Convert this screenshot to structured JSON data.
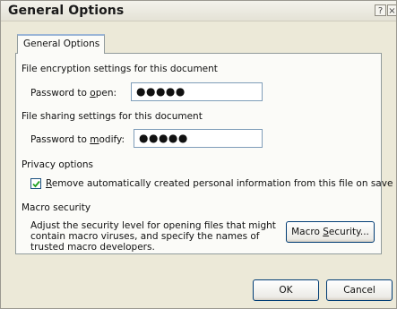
{
  "window": {
    "title": "General Options",
    "help_glyph": "?",
    "close_glyph": "×"
  },
  "tab": {
    "label": "General Options"
  },
  "encryption": {
    "heading": "File encryption settings for this document",
    "open_label_pre": "Password to ",
    "open_label_key": "o",
    "open_label_post": "pen:",
    "open_value": "●●●●●"
  },
  "sharing": {
    "heading": "File sharing settings for this document",
    "modify_label_pre": "Password to ",
    "modify_label_key": "m",
    "modify_label_post": "odify:",
    "modify_value": "●●●●●"
  },
  "privacy": {
    "heading": "Privacy options",
    "checkbox_checked": true,
    "checkbox_label_key": "R",
    "checkbox_label_rest": "emove automatically created personal information from this file on save"
  },
  "macro": {
    "heading": "Macro security",
    "description_line1": "Adjust the security level for opening files that might",
    "description_line2": "contain macro viruses, and specify the names of",
    "description_line3": "trusted macro developers.",
    "button_pre": "Macro ",
    "button_key": "S",
    "button_post": "ecurity..."
  },
  "footer": {
    "ok_label": "OK",
    "cancel_label": "Cancel"
  }
}
